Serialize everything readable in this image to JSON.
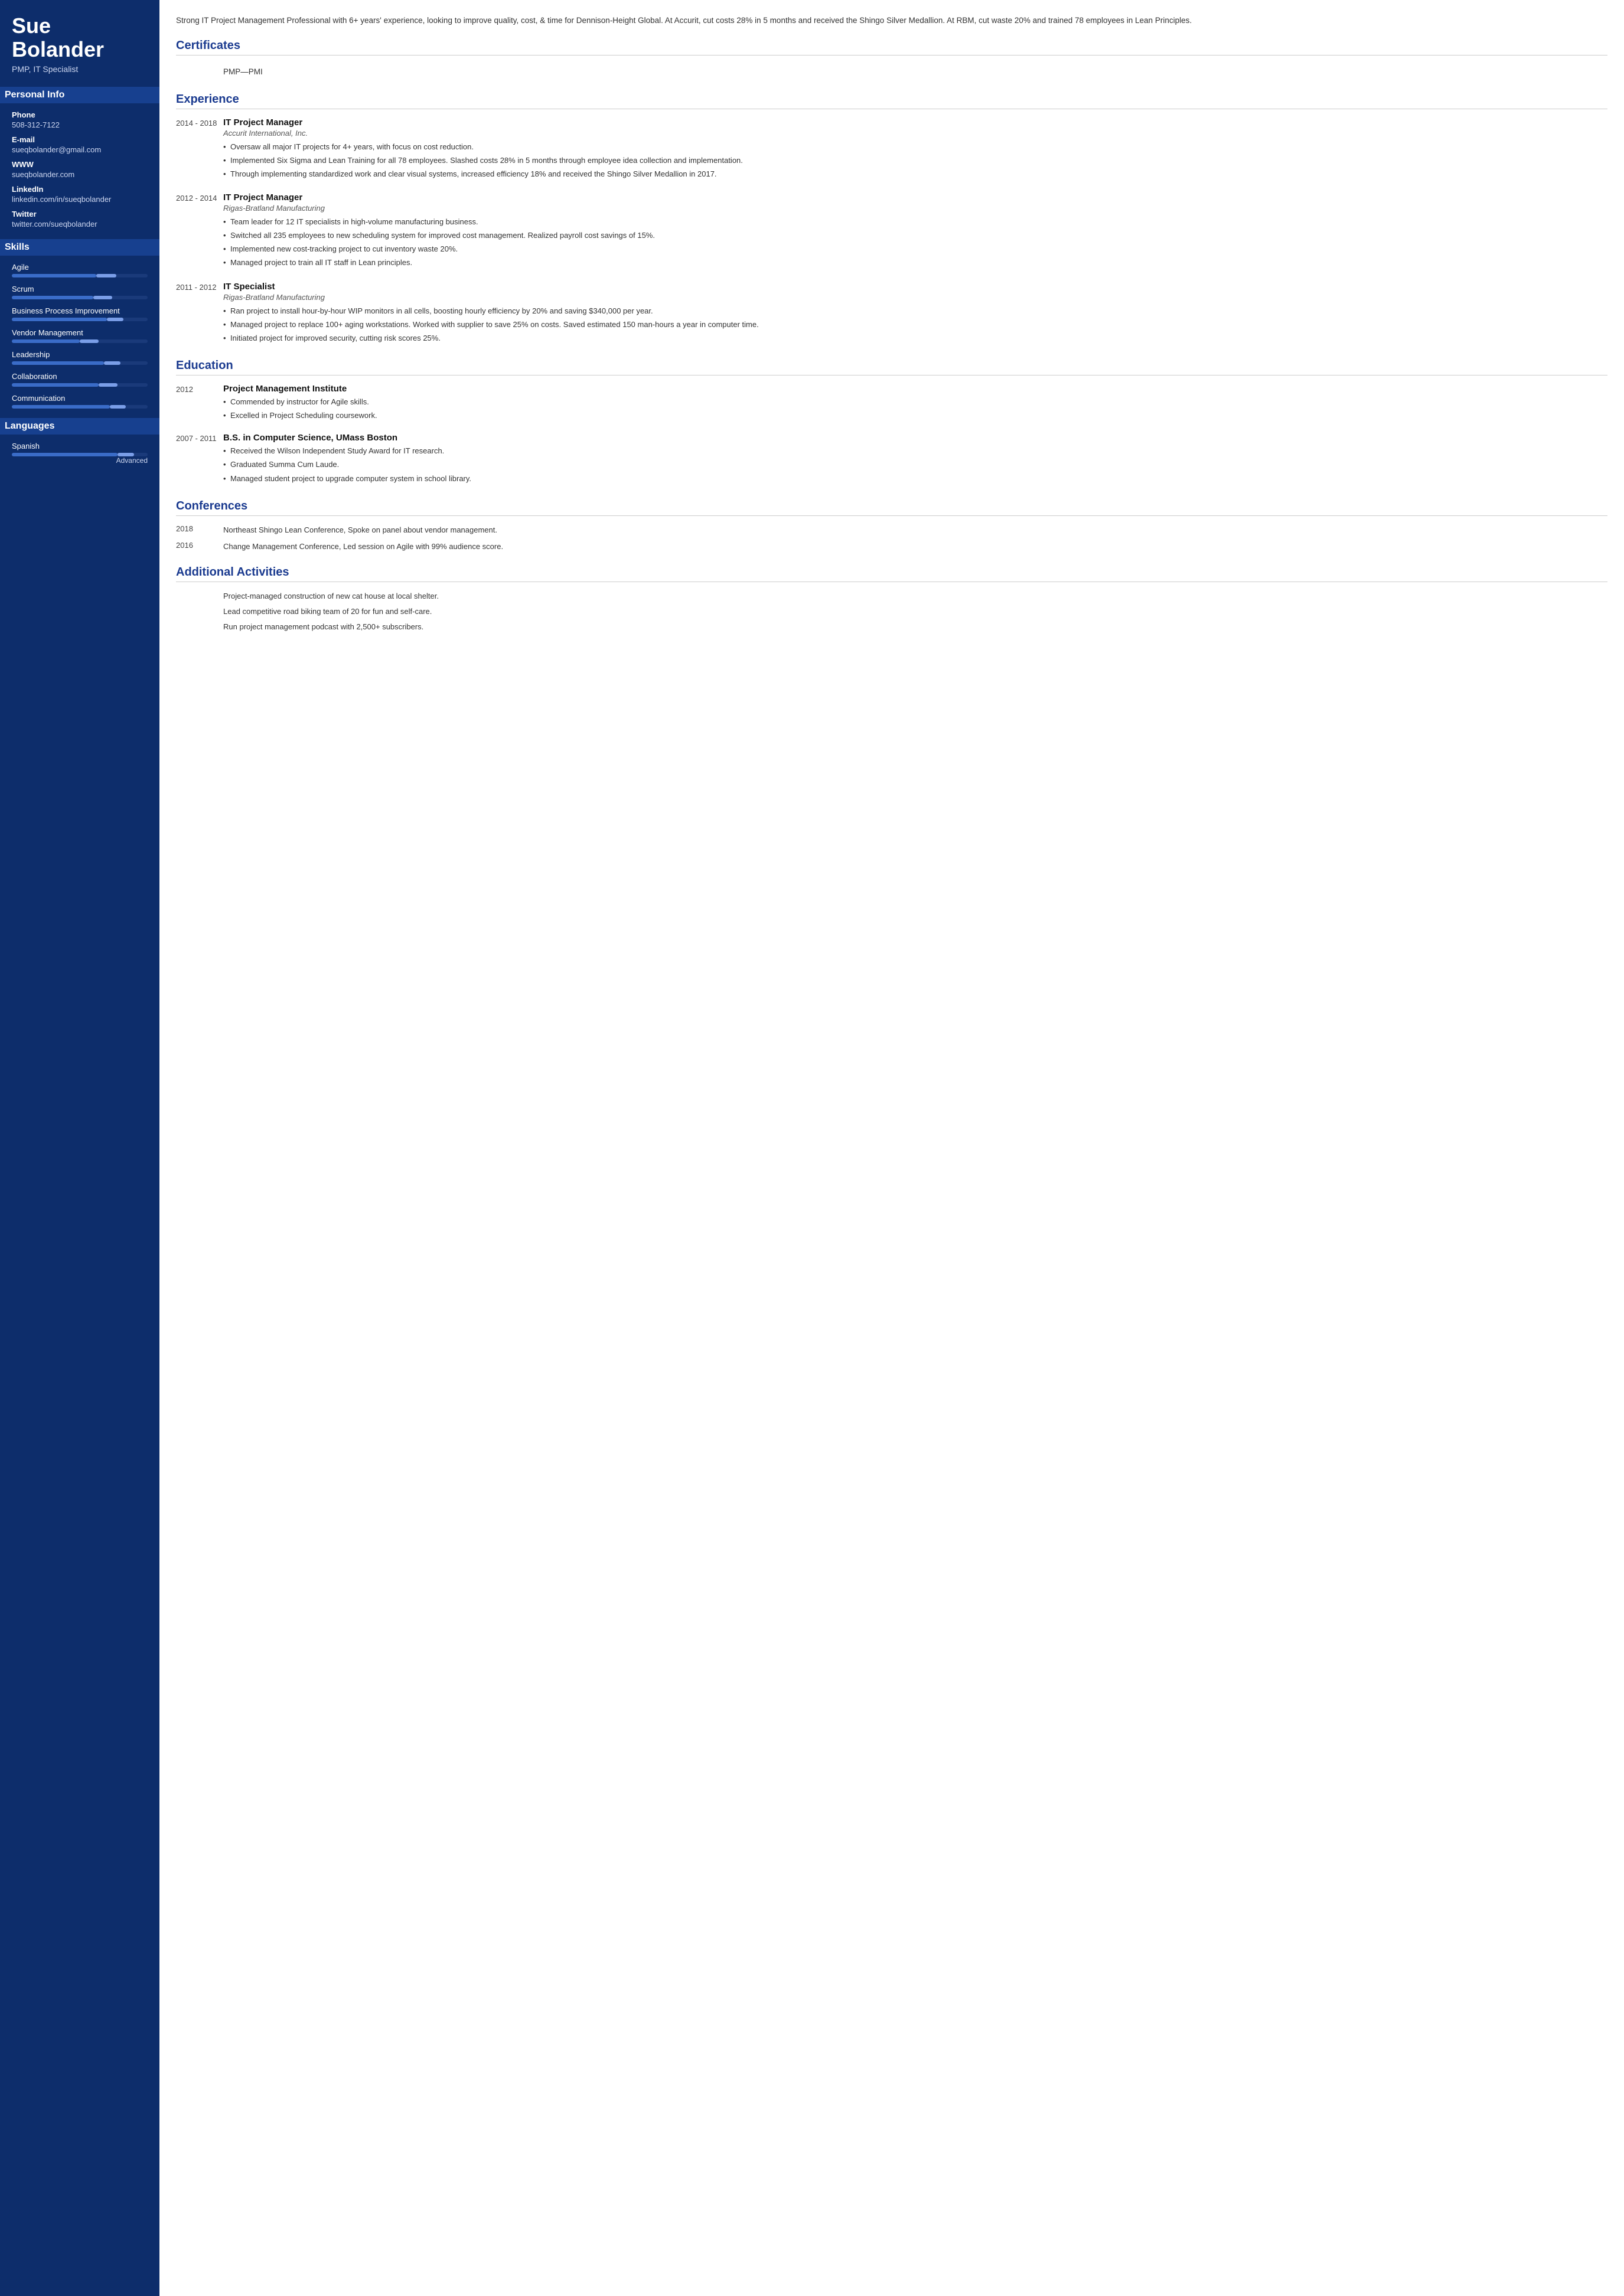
{
  "sidebar": {
    "name": "Sue Bolander",
    "title": "PMP, IT Specialist",
    "sections": {
      "personal_info": "Personal Info",
      "skills": "Skills",
      "languages": "Languages"
    },
    "contact": [
      {
        "label": "Phone",
        "value": "508-312-7122"
      },
      {
        "label": "E-mail",
        "value": "sueqbolander@gmail.com"
      },
      {
        "label": "WWW",
        "value": "sueqbolander.com"
      },
      {
        "label": "LinkedIn",
        "value": "linkedin.com/in/sueqbolander"
      },
      {
        "label": "Twitter",
        "value": "twitter.com/sueqbolander"
      }
    ],
    "skills": [
      {
        "name": "Agile",
        "fill": 62,
        "accent_start": 62,
        "accent_width": 15
      },
      {
        "name": "Scrum",
        "fill": 60,
        "accent_start": 60,
        "accent_width": 14
      },
      {
        "name": "Business Process Improvement",
        "fill": 70,
        "accent_start": 70,
        "accent_width": 12
      },
      {
        "name": "Vendor Management",
        "fill": 50,
        "accent_start": 50,
        "accent_width": 14
      },
      {
        "name": "Leadership",
        "fill": 68,
        "accent_start": 68,
        "accent_width": 12
      },
      {
        "name": "Collaboration",
        "fill": 64,
        "accent_start": 64,
        "accent_width": 14
      },
      {
        "name": "Communication",
        "fill": 72,
        "accent_start": 72,
        "accent_width": 12
      }
    ],
    "languages": [
      {
        "name": "Spanish",
        "fill": 78,
        "accent_start": 78,
        "accent_width": 12,
        "level": "Advanced"
      }
    ]
  },
  "main": {
    "summary": "Strong IT Project Management Professional with 6+ years' experience, looking to improve quality, cost, & time for Dennison-Height Global. At Accurit, cut costs 28% in 5 months and received the Shingo Silver Medallion. At RBM, cut waste 20% and trained 78 employees in Lean Principles.",
    "certificates_title": "Certificates",
    "certificates": [
      {
        "text": "PMP—PMI"
      }
    ],
    "experience_title": "Experience",
    "experience": [
      {
        "date": "2014 - 2018",
        "title": "IT Project Manager",
        "company": "Accurit International, Inc.",
        "bullets": [
          "Oversaw all major IT projects for 4+ years, with focus on cost reduction.",
          "Implemented Six Sigma and Lean Training for all 78 employees. Slashed costs 28% in 5 months through employee idea collection and implementation.",
          "Through implementing standardized work and clear visual systems, increased efficiency 18% and received the Shingo Silver Medallion in 2017."
        ]
      },
      {
        "date": "2012 - 2014",
        "title": "IT Project Manager",
        "company": "Rigas-Bratland Manufacturing",
        "bullets": [
          "Team leader for 12 IT specialists in high-volume manufacturing business.",
          "Switched all 235 employees to new scheduling system for improved cost management. Realized payroll cost savings of 15%.",
          "Implemented new cost-tracking project to cut inventory waste 20%.",
          "Managed project to train all IT staff in Lean principles."
        ]
      },
      {
        "date": "2011 - 2012",
        "title": "IT Specialist",
        "company": "Rigas-Bratland Manufacturing",
        "bullets": [
          "Ran project to install hour-by-hour WIP monitors in all cells, boosting hourly efficiency by 20% and saving $340,000 per year.",
          "Managed project to replace 100+ aging workstations. Worked with supplier to save 25% on costs. Saved estimated 150 man-hours a year in computer time.",
          "Initiated project for improved security, cutting risk scores 25%."
        ]
      }
    ],
    "education_title": "Education",
    "education": [
      {
        "date": "2012",
        "title": "Project Management Institute",
        "company": "",
        "bullets": [
          "Commended by instructor for Agile skills.",
          "Excelled in Project Scheduling coursework."
        ]
      },
      {
        "date": "2007 - 2011",
        "title": "B.S. in Computer Science, UMass Boston",
        "company": "",
        "bullets": [
          "Received the Wilson Independent Study Award for IT research.",
          "Graduated Summa Cum Laude.",
          "Managed student project to upgrade computer system in school library."
        ]
      }
    ],
    "conferences_title": "Conferences",
    "conferences": [
      {
        "date": "2018",
        "text": "Northeast Shingo Lean Conference, Spoke on panel about vendor management."
      },
      {
        "date": "2016",
        "text": "Change Management Conference, Led session on Agile with 99% audience score."
      }
    ],
    "activities_title": "Additional Activities",
    "activities": [
      "Project-managed construction of new cat house at local shelter.",
      "Lead competitive road biking team of 20 for fun and self-care.",
      "Run project management podcast with 2,500+ subscribers."
    ]
  }
}
